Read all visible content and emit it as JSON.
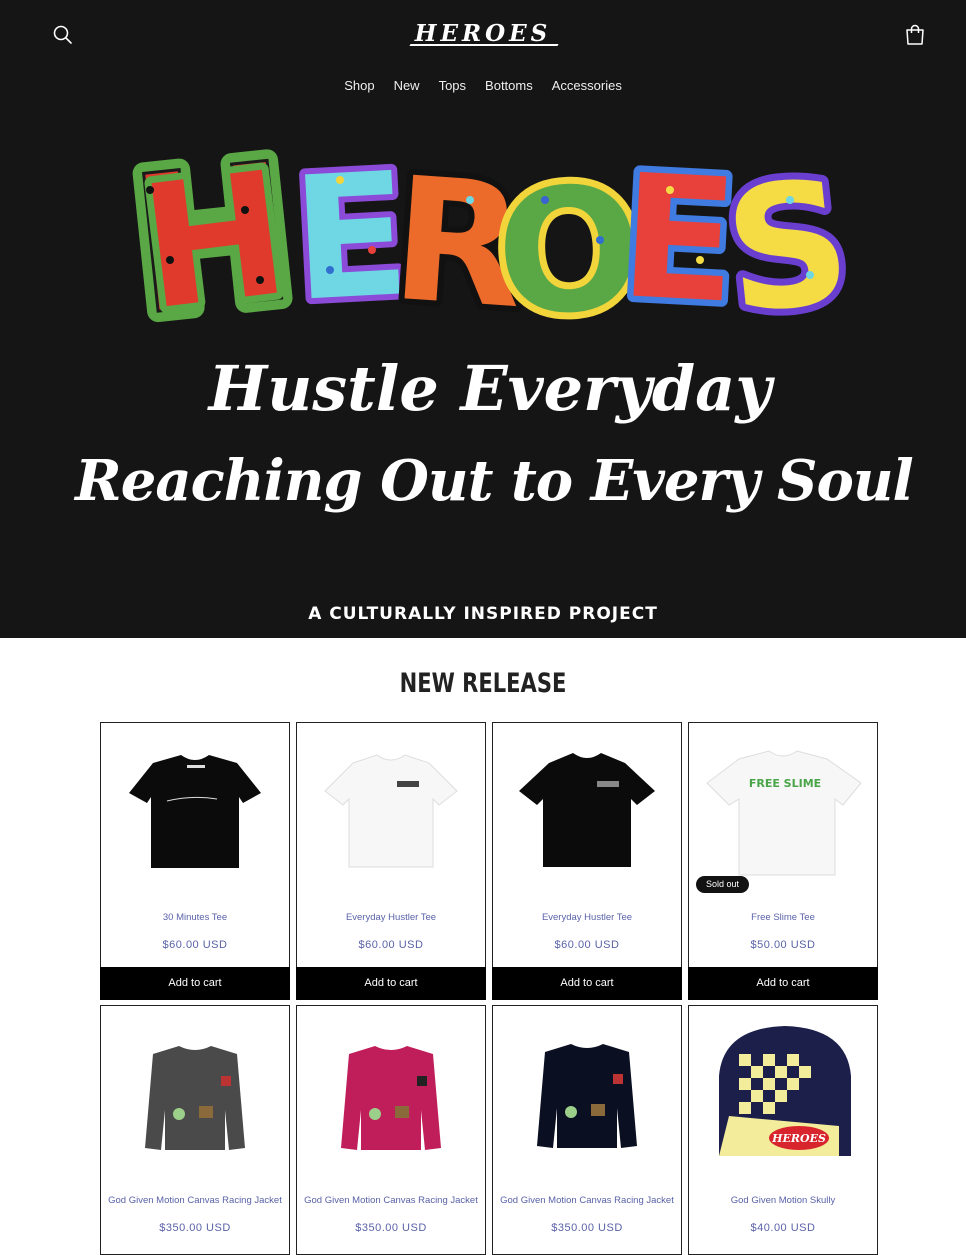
{
  "header": {
    "logo_text": "HEROES",
    "nav": [
      "Shop",
      "New",
      "Tops",
      "Bottoms",
      "Accessories"
    ],
    "search_icon": "search-icon",
    "cart_icon": "cart-icon"
  },
  "hero": {
    "wordmark": "HEROES",
    "line1": "Hustle Everyday",
    "line2": "Reaching Out to Every Soul",
    "tagline": "A CULTURALLY INSPIRED PROJECT",
    "letter_colors": [
      "#e03a2d",
      "#6fd7e4",
      "#ec6a2a",
      "#f2d43b",
      "#e8413b",
      "#f5dc45"
    ]
  },
  "section": {
    "title": "NEW RELEASE"
  },
  "products": [
    {
      "name": "30 Minutes Tee",
      "price": "$60.00 USD",
      "button": "Add to cart"
    },
    {
      "name": "Everyday Hustler Tee",
      "price": "$60.00 USD",
      "button": "Add to cart"
    },
    {
      "name": "Everyday Hustler Tee",
      "price": "$60.00 USD",
      "button": "Add to cart"
    },
    {
      "name": "Free Slime Tee",
      "price": "$50.00 USD",
      "button": "Add to cart",
      "badge": "Sold out",
      "print_text": "FREE SLIME"
    },
    {
      "name": "God Given Motion Canvas Racing Jacket",
      "price": "$350.00 USD"
    },
    {
      "name": "God Given Motion Canvas Racing Jacket",
      "price": "$350.00 USD"
    },
    {
      "name": "God Given Motion Canvas Racing Jacket",
      "price": "$350.00 USD"
    },
    {
      "name": "God Given Motion Skully",
      "price": "$40.00 USD",
      "patch_text": "HEROES"
    }
  ],
  "colors": {
    "header_bg": "#151515",
    "link": "#5a62a8",
    "button_bg": "#000000"
  }
}
